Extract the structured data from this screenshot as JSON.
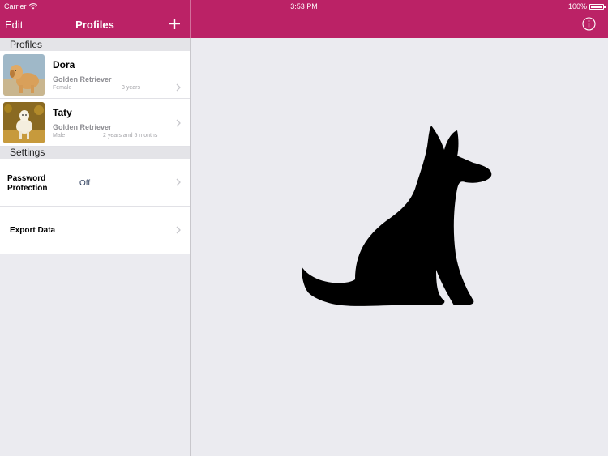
{
  "status_bar": {
    "carrier": "Carrier",
    "time": "3:53 PM",
    "battery": "100%"
  },
  "nav": {
    "edit_label": "Edit",
    "title": "Profiles",
    "add_icon": "plus-icon",
    "info_icon": "info-icon"
  },
  "sections": {
    "profiles_header": "Profiles",
    "settings_header": "Settings"
  },
  "profiles": [
    {
      "name": "Dora",
      "breed": "Golden Retriever",
      "sex": "Female",
      "age": "3 years"
    },
    {
      "name": "Taty",
      "breed": "Golden Retriever",
      "sex": "Male",
      "age": "2 years and 5 months"
    }
  ],
  "settings": {
    "password": {
      "label": "Password Protection",
      "value": "Off"
    },
    "export": {
      "label": "Export Data"
    }
  },
  "colors": {
    "accent": "#bb2266",
    "background": "#ebebf0"
  }
}
